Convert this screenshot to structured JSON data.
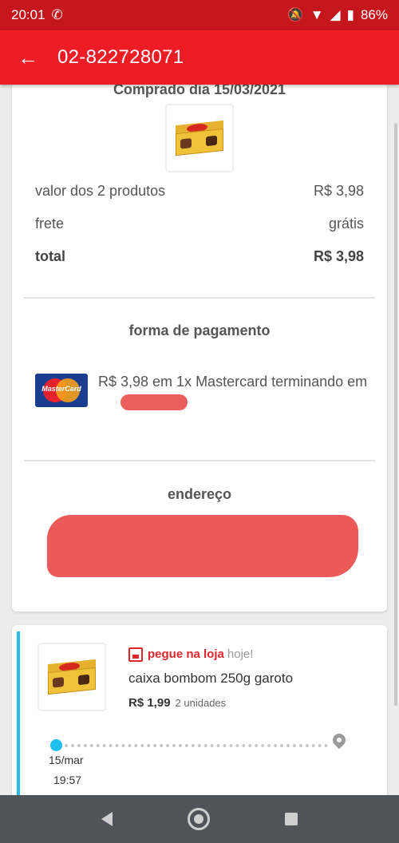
{
  "status_bar": {
    "time": "20:01",
    "battery": "86%"
  },
  "app_bar": {
    "title": "02-822728071"
  },
  "order": {
    "purchased_label": "Comprado dia 15/03/2021",
    "summary": [
      {
        "label": "valor dos 2 produtos",
        "value": "R$ 3,98"
      },
      {
        "label": "frete",
        "value": "grátis"
      },
      {
        "label": "total",
        "value": "R$ 3,98"
      }
    ],
    "payment": {
      "title": "forma de pagamento",
      "card_brand": "MasterCard",
      "text": "R$ 3,98 em 1x Mastercard terminando em"
    },
    "address": {
      "title": "endereço"
    }
  },
  "item": {
    "pickup_label": "pegue na loja",
    "pickup_when": "hoje!",
    "name": "caixa bombom 250g garoto",
    "price": "R$ 1,99",
    "units": "2 unidades",
    "tracking_date": "15/mar",
    "tracking_time": "19:57"
  },
  "colors": {
    "primary": "#ee1c25",
    "status": "#c4161c",
    "accent": "#2bbbe8"
  }
}
